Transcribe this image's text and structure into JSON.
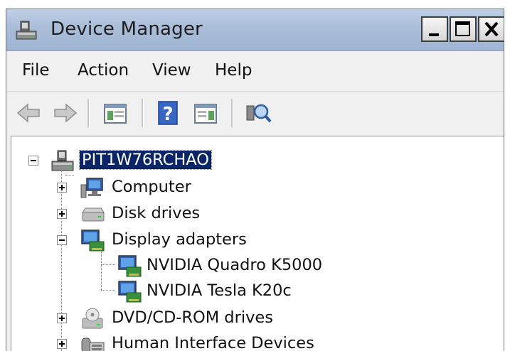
{
  "window": {
    "title": "Device Manager",
    "controls": [
      "minimize",
      "maximize",
      "close"
    ]
  },
  "menu": {
    "items": [
      "File",
      "Action",
      "View",
      "Help"
    ]
  },
  "toolbar": {
    "buttons": [
      "back-arrow",
      "forward-arrow",
      "show-hide-console-tree",
      "help",
      "properties",
      "scan-for-hardware-changes"
    ]
  },
  "tree": {
    "root": {
      "label": "PIT1W76RCHAO",
      "expanded": true,
      "selected": true
    },
    "categories": [
      {
        "label": "Computer",
        "expanded": false,
        "icon": "computer-icon"
      },
      {
        "label": "Disk drives",
        "expanded": false,
        "icon": "disk-drive-icon"
      },
      {
        "label": "Display adapters",
        "expanded": true,
        "icon": "display-adapter-icon",
        "children": [
          {
            "label": "NVIDIA Quadro K5000",
            "icon": "display-adapter-icon"
          },
          {
            "label": "NVIDIA Tesla K20c",
            "icon": "display-adapter-icon"
          }
        ]
      },
      {
        "label": "DVD/CD-ROM drives",
        "expanded": false,
        "icon": "dvd-drive-icon"
      },
      {
        "label": "Human Interface Devices",
        "expanded": false,
        "icon": "hid-icon"
      }
    ]
  },
  "colors": {
    "selection": "#0a246a",
    "title_gradient_top": "#bfd0e6",
    "title_gradient_bottom": "#9fb5d3"
  }
}
